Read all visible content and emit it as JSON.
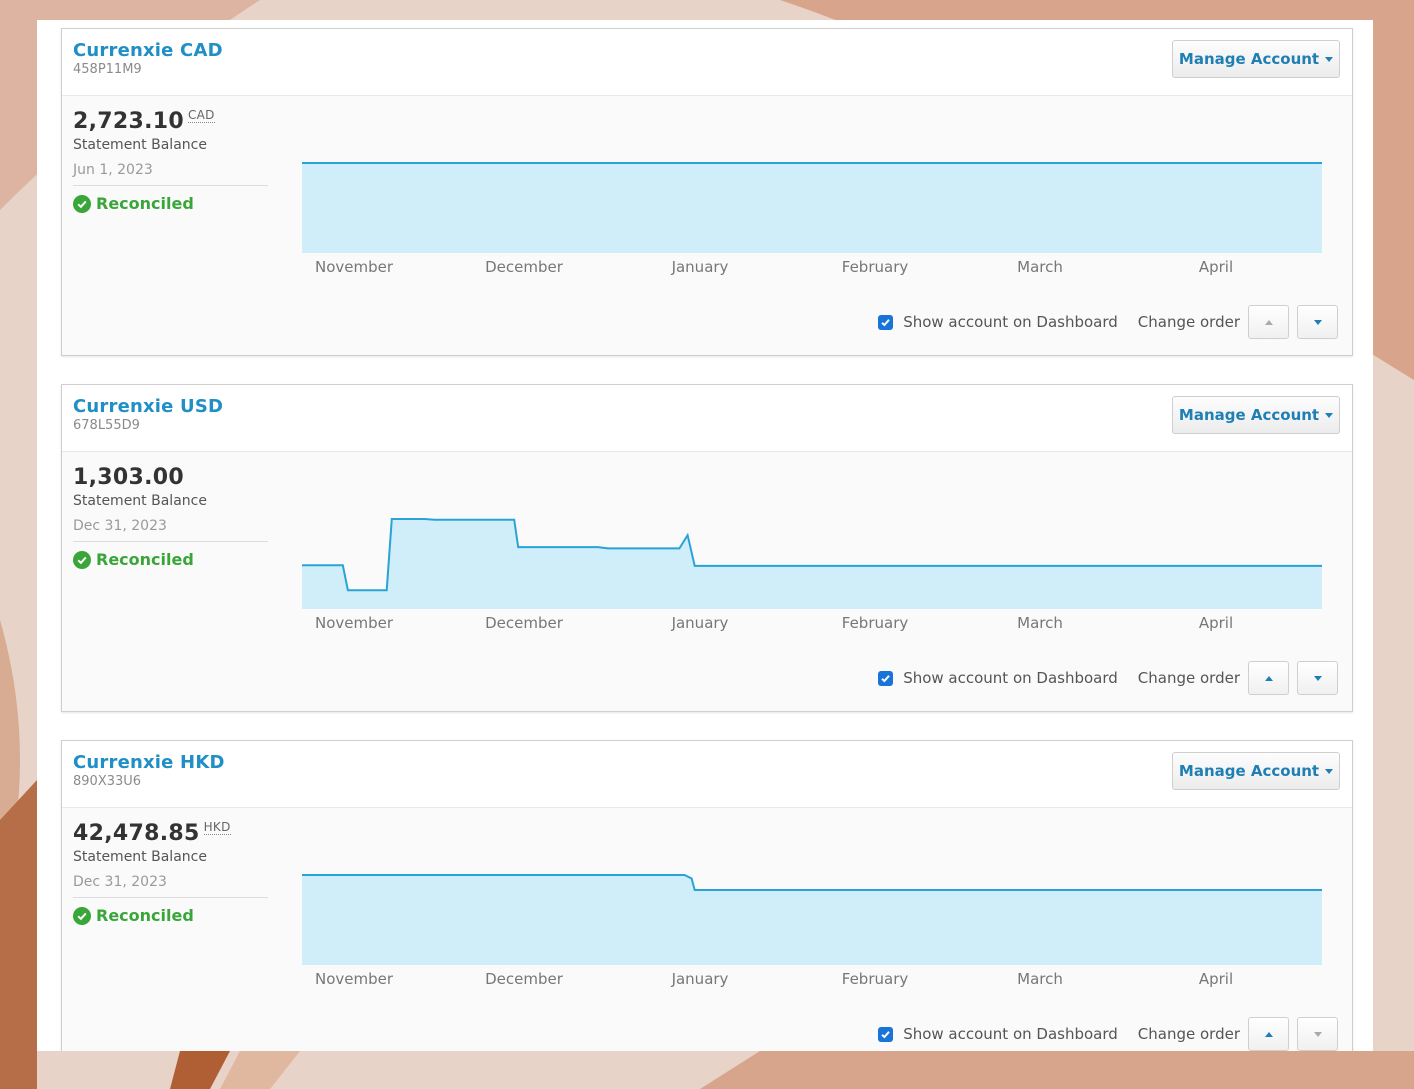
{
  "theme": {
    "accent": "#1f8fc5",
    "reconciled_color": "#3aa63a",
    "area_fill": "#cfeefa",
    "line_color": "#29a3d6"
  },
  "month_labels": [
    "November",
    "December",
    "January",
    "February",
    "March",
    "April"
  ],
  "show_on_dashboard_label": "Show account on Dashboard",
  "change_order_label": "Change order",
  "manage_label": "Manage Account",
  "accounts": [
    {
      "name": "Currenxie CAD",
      "number": "458P11M9",
      "balance": "2,723.10",
      "currency": "CAD",
      "balance_label": "Statement Balance",
      "date": "Jun 1, 2023",
      "status": "Reconciled",
      "show_on_dashboard": true,
      "move_up_enabled": false,
      "move_down_enabled": true,
      "chart_data": {
        "type": "area",
        "x": [
          "November",
          "December",
          "January",
          "February",
          "March",
          "April"
        ],
        "points": [
          [
            0,
            2723.1
          ],
          [
            1,
            2723.1
          ]
        ],
        "ylim": [
          0,
          2723.1
        ]
      }
    },
    {
      "name": "Currenxie USD",
      "number": "678L55D9",
      "balance": "1,303.00",
      "currency": "",
      "balance_label": "Statement Balance",
      "date": "Dec 31, 2023",
      "status": "Reconciled",
      "show_on_dashboard": true,
      "move_up_enabled": true,
      "move_down_enabled": true,
      "chart_data": {
        "type": "area",
        "x": [
          "November",
          "December",
          "January",
          "February",
          "March",
          "April"
        ],
        "points": [
          [
            0,
            1320
          ],
          [
            0.04,
            1320
          ],
          [
            0.045,
            568
          ],
          [
            0.083,
            568
          ],
          [
            0.088,
            2720
          ],
          [
            0.12,
            2720
          ],
          [
            0.13,
            2700
          ],
          [
            0.208,
            2700
          ],
          [
            0.212,
            1870
          ],
          [
            0.29,
            1870
          ],
          [
            0.3,
            1830
          ],
          [
            0.37,
            1830
          ],
          [
            0.378,
            2230
          ],
          [
            0.385,
            1303
          ],
          [
            1,
            1303
          ]
        ],
        "ylim": [
          0,
          2720
        ]
      }
    },
    {
      "name": "Currenxie HKD",
      "number": "890X33U6",
      "balance": "42,478.85",
      "currency": "HKD",
      "balance_label": "Statement Balance",
      "date": "Dec 31, 2023",
      "status": "Reconciled",
      "show_on_dashboard": true,
      "move_up_enabled": true,
      "move_down_enabled": false,
      "chart_data": {
        "type": "area",
        "x": [
          "November",
          "December",
          "January",
          "February",
          "March",
          "April"
        ],
        "points": [
          [
            0,
            51000
          ],
          [
            0.375,
            51000
          ],
          [
            0.382,
            49000
          ],
          [
            0.385,
            42478.85
          ],
          [
            1,
            42478.85
          ]
        ],
        "ylim": [
          0,
          51000
        ]
      }
    }
  ]
}
